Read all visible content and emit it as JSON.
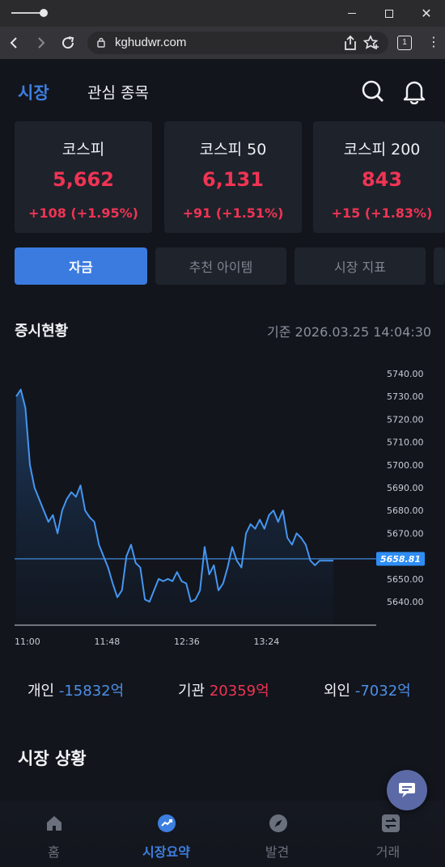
{
  "browser": {
    "url": "kghudwr.com",
    "tab_count": "1"
  },
  "header": {
    "tabs": [
      {
        "label": "시장",
        "active": true
      },
      {
        "label": "관심 종목",
        "active": false
      }
    ]
  },
  "indices": [
    {
      "name": "코스피",
      "value": "5,662",
      "change": "+108 (+1.95%)"
    },
    {
      "name": "코스피 50",
      "value": "6,131",
      "change": "+91 (+1.51%)"
    },
    {
      "name": "코스피 200",
      "value": "843",
      "change": "+15 (+1.83%)"
    }
  ],
  "segments": [
    {
      "label": "자금",
      "active": true
    },
    {
      "label": "추천 아이템",
      "active": false
    },
    {
      "label": "시장 지표",
      "active": false
    }
  ],
  "market_status": {
    "title": "증시현황",
    "basis": "기준 2026.03.25 14:04:30"
  },
  "chart_data": {
    "type": "area",
    "x_ticks": [
      "11:00",
      "11:48",
      "12:36",
      "13:24"
    ],
    "y_ticks": [
      "5740.00",
      "5730.00",
      "5720.00",
      "5710.00",
      "5700.00",
      "5690.00",
      "5680.00",
      "5670.00",
      "5650.00",
      "5640.00"
    ],
    "ylim": [
      5634,
      5745
    ],
    "current_value": "5658.81",
    "current_value_num": 5658.81,
    "x_minutes": [
      0,
      3,
      6,
      9,
      12,
      15,
      18,
      21,
      24,
      27,
      30,
      33,
      36,
      39,
      42,
      45,
      48,
      51,
      54,
      57,
      60,
      63,
      66,
      69,
      72,
      75,
      78,
      81,
      84,
      87,
      90,
      93,
      96,
      99,
      102,
      105,
      108,
      111,
      114,
      117,
      120,
      123,
      126,
      129,
      132,
      135,
      138,
      141,
      144,
      147,
      150,
      153,
      156,
      159,
      162,
      165,
      168,
      171,
      174,
      177,
      180,
      183,
      186,
      189,
      192,
      195,
      198,
      201,
      204,
      207
    ],
    "values": [
      5730,
      5733,
      5725,
      5700,
      5690,
      5685,
      5680,
      5675,
      5678,
      5670,
      5680,
      5685,
      5688,
      5686,
      5691,
      5680,
      5677,
      5675,
      5665,
      5660,
      5655,
      5648,
      5642,
      5645,
      5660,
      5665,
      5657,
      5655,
      5641,
      5640,
      5645,
      5650,
      5649,
      5650,
      5649,
      5653,
      5649,
      5648,
      5640,
      5641,
      5645,
      5664,
      5652,
      5656,
      5645,
      5648,
      5655,
      5664,
      5658,
      5655,
      5670,
      5674,
      5672,
      5676,
      5672,
      5678,
      5680,
      5675,
      5680,
      5668,
      5665,
      5670,
      5668,
      5665,
      5658,
      5656,
      5658,
      5658,
      5658,
      5658
    ]
  },
  "flows": [
    {
      "label": "개인",
      "value": "-15832억",
      "sign": "neg"
    },
    {
      "label": "기관",
      "value": "20359억",
      "sign": "pos"
    },
    {
      "label": "외인",
      "value": "-7032억",
      "sign": "neg"
    }
  ],
  "section2": {
    "title": "시장 상황"
  },
  "bottom_nav": [
    {
      "label": "홈",
      "icon": "home-icon",
      "active": false
    },
    {
      "label": "시장요약",
      "icon": "trend-icon",
      "active": true
    },
    {
      "label": "발견",
      "icon": "compass-icon",
      "active": false
    },
    {
      "label": "거래",
      "icon": "exchange-icon",
      "active": false
    }
  ],
  "colors": {
    "accent": "#3b7be0",
    "up": "#ef3454",
    "down": "#4d8fe8",
    "line": "#4596f0"
  }
}
